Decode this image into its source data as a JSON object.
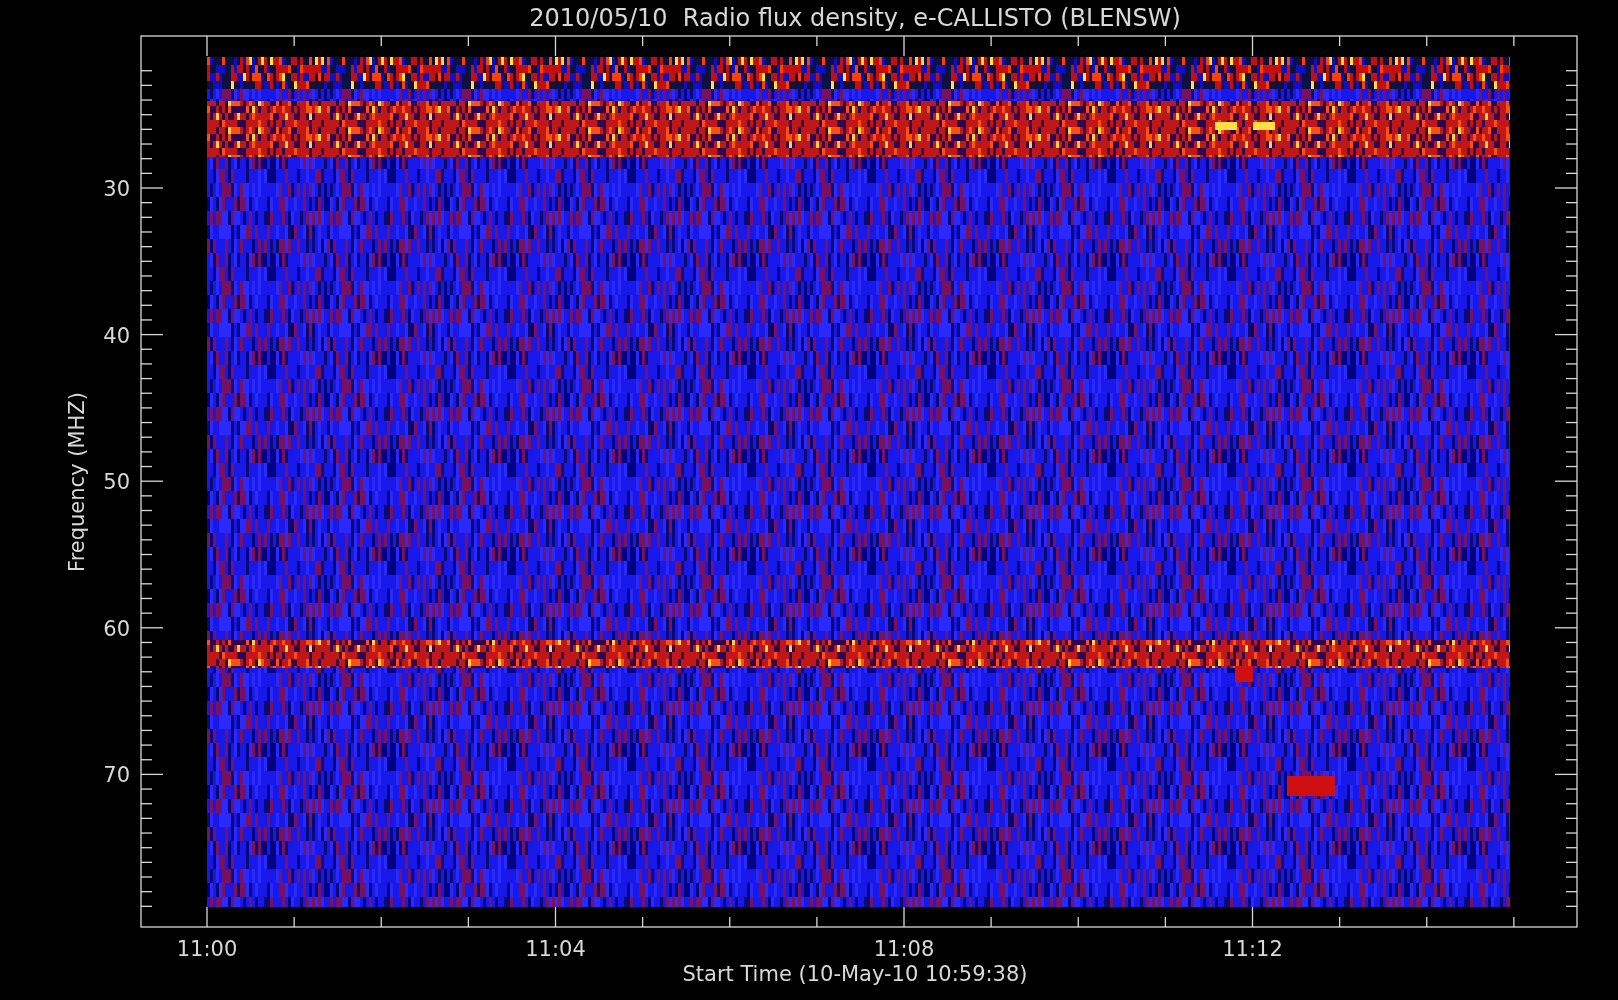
{
  "title": "2010/05/10  Radio flux density, e-CALLISTO (BLENSW)",
  "x_axis": {
    "label": "Start Time (10-May-10 10:59:38)",
    "ticks": [
      "11:00",
      "11:04",
      "11:08",
      "11:12"
    ]
  },
  "y_axis": {
    "label": "Frequency (MHZ)",
    "ticks": [
      "30",
      "40",
      "50",
      "60",
      "70"
    ]
  }
}
